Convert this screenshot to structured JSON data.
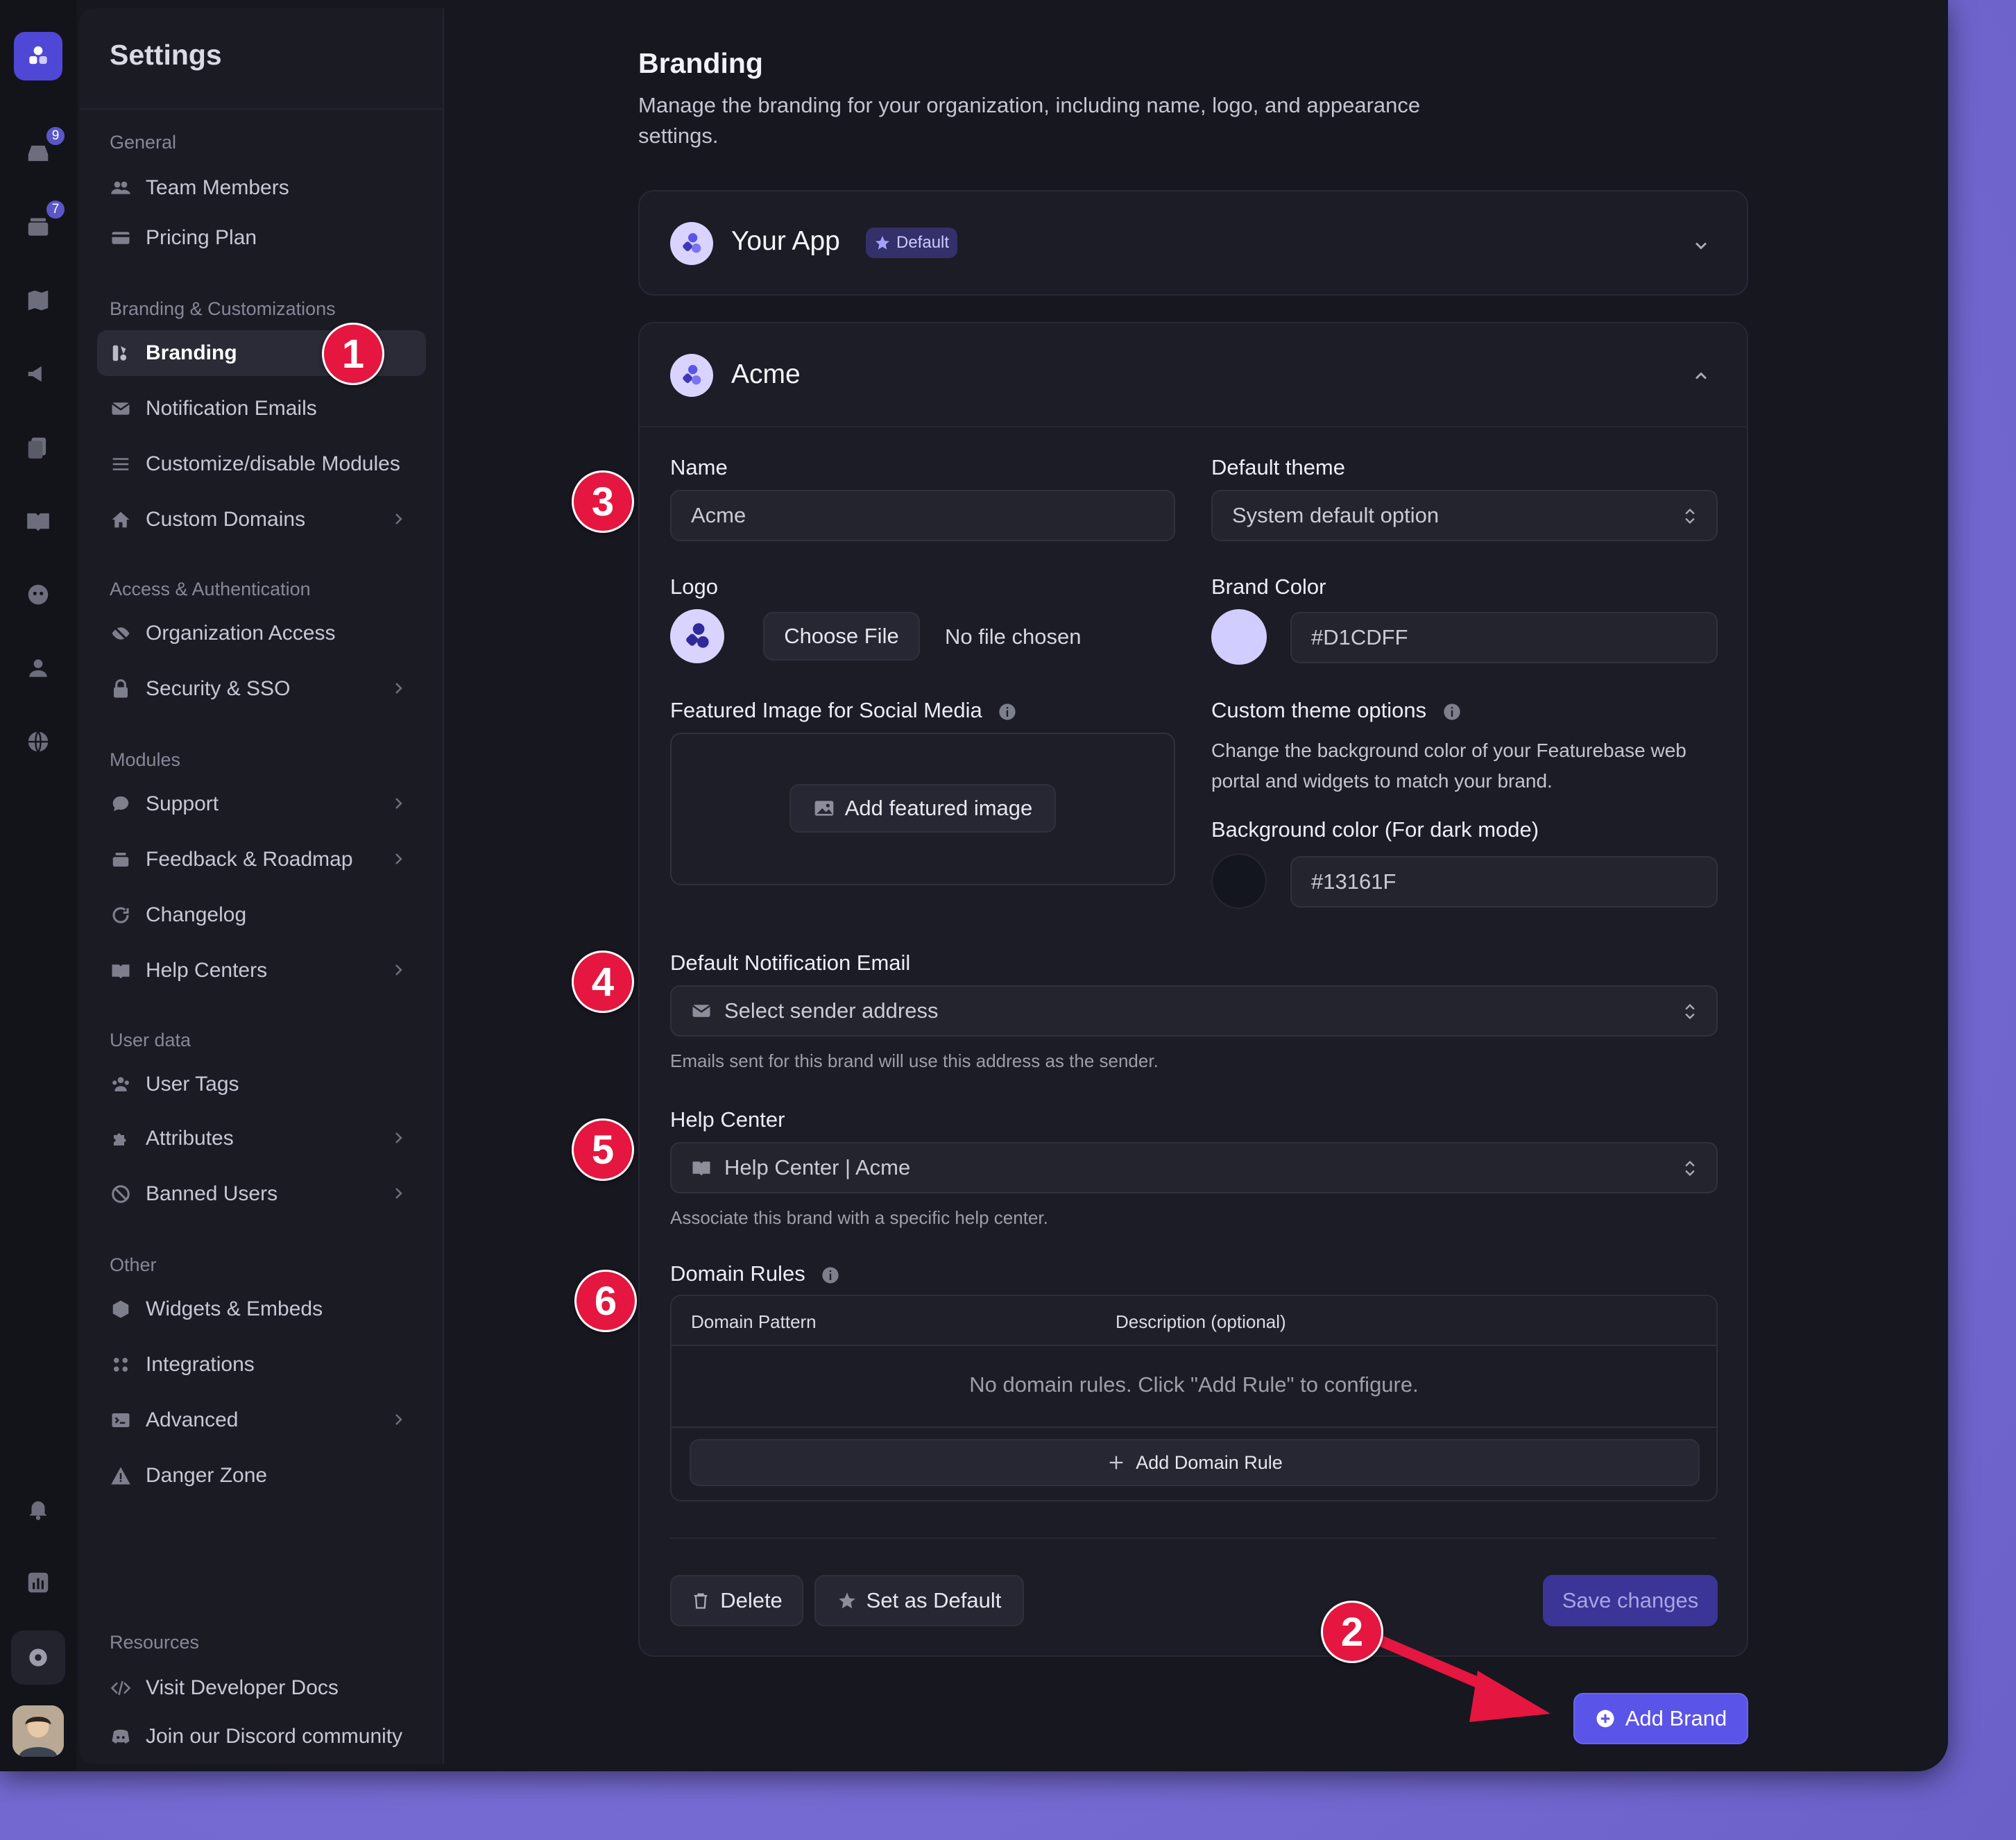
{
  "sidebar": {
    "title": "Settings",
    "sections": {
      "general": "General",
      "branding": "Branding & Customizations",
      "access": "Access & Authentication",
      "modules": "Modules",
      "userdata": "User data",
      "other": "Other",
      "resources": "Resources"
    },
    "items": {
      "team_members": "Team Members",
      "pricing_plan": "Pricing Plan",
      "branding": "Branding",
      "notification_emails": "Notification Emails",
      "customize_modules": "Customize/disable Modules",
      "custom_domains": "Custom Domains",
      "organization_access": "Organization Access",
      "security_sso": "Security & SSO",
      "support": "Support",
      "feedback_roadmap": "Feedback & Roadmap",
      "changelog": "Changelog",
      "help_centers": "Help Centers",
      "user_tags": "User Tags",
      "attributes": "Attributes",
      "banned_users": "Banned Users",
      "widgets_embeds": "Widgets & Embeds",
      "integrations": "Integrations",
      "advanced": "Advanced",
      "danger_zone": "Danger Zone",
      "developer_docs": "Visit Developer Docs",
      "discord": "Join our Discord community"
    }
  },
  "rail": {
    "badges": {
      "inbox": "9",
      "posts": "7"
    }
  },
  "page": {
    "title": "Branding",
    "description": "Manage the branding for your organization, including name, logo, and appearance settings."
  },
  "brand_default": {
    "name": "Your App",
    "badge": "Default"
  },
  "brand_acme": {
    "name": "Acme",
    "name_label": "Name",
    "name_value": "Acme",
    "theme_label": "Default theme",
    "theme_value": "System default option",
    "logo_label": "Logo",
    "choose_file": "Choose File",
    "no_file": "No file chosen",
    "brand_color_label": "Brand Color",
    "brand_color_value": "#D1CDFF",
    "featured_image_label": "Featured Image for Social Media",
    "add_featured_image": "Add featured image",
    "custom_theme_label": "Custom theme options",
    "custom_theme_desc": "Change the background color of your Featurebase web portal and widgets to match your brand.",
    "bg_color_label": "Background color (For dark mode)",
    "bg_color_value": "#13161F",
    "notif_email_label": "Default Notification Email",
    "notif_email_placeholder": "Select sender address",
    "notif_email_help": "Emails sent for this brand will use this address as the sender.",
    "help_center_label": "Help Center",
    "help_center_value": "Help Center | Acme",
    "help_center_help": "Associate this brand with a specific help center.",
    "domain_rules_label": "Domain Rules",
    "domain_pattern_header": "Domain Pattern",
    "description_header": "Description (optional)",
    "domain_empty": "No domain rules. Click \"Add Rule\" to configure.",
    "add_domain_rule": "Add Domain Rule",
    "delete": "Delete",
    "set_default": "Set as Default",
    "save": "Save changes"
  },
  "add_brand": "Add Brand",
  "annotations": {
    "n1": "1",
    "n2": "2",
    "n3": "3",
    "n4": "4",
    "n5": "5",
    "n6": "6"
  },
  "colors": {
    "accent": "#5B54E8",
    "brand": "#D1CDFF",
    "background_dark": "#13161F",
    "marker": "#E5163F"
  }
}
